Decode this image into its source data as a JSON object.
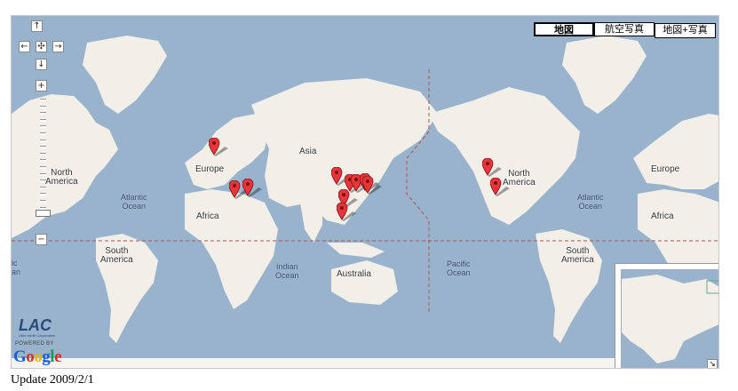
{
  "map": {
    "type_buttons": [
      {
        "label": "地図",
        "active": true
      },
      {
        "label": "航空写真",
        "active": false
      },
      {
        "label": "地図+写真",
        "active": false
      }
    ],
    "nav_controls": {
      "up": "↑",
      "down": "↓",
      "left": "←",
      "right": "→",
      "center": "✣",
      "zoom_in": "+",
      "zoom_out": "−"
    },
    "zoom_level_fraction": 0.05,
    "labels": {
      "north_america_left": "North\nAmerica",
      "europe_left": "Europe",
      "asia": "Asia",
      "africa_left": "Africa",
      "atlantic_left": "Atlantic\nOcean",
      "south_america_left": "South\nAmerica",
      "indian_ocean": "Indian\nOcean",
      "australia": "Australia",
      "pacific_ocean": "Pacific\nOcean",
      "north_america_right": "North\nAmerica",
      "atlantic_right": "Atlantic\nOcean",
      "europe_right": "Europe",
      "africa_right": "Africa",
      "south_america_right": "South\nAmerica",
      "antarctic_fragment": "ic\nan"
    },
    "markers": [
      {
        "name": "Finland"
      },
      {
        "name": "Turkey"
      },
      {
        "name": "Iran"
      },
      {
        "name": "Beijing"
      },
      {
        "name": "Korea"
      },
      {
        "name": "Korea 2"
      },
      {
        "name": "Japan"
      },
      {
        "name": "Tokyo"
      },
      {
        "name": "Shanghai"
      },
      {
        "name": "Taiwan"
      },
      {
        "name": "Seattle"
      },
      {
        "name": "San Francisco"
      }
    ],
    "overview_toggle": "↘",
    "colors": {
      "water": "#99b3cc",
      "land": "#f2efe9",
      "marker": "#e8343a",
      "border_line": "#b05050"
    }
  },
  "branding": {
    "lac_logo": "LAC",
    "lac_subtitle": "Little eArth Corporation",
    "powered_by": "POWERED BY",
    "google": [
      "G",
      "o",
      "o",
      "g",
      "l",
      "e"
    ],
    "google_colors": [
      "#1a5bd6",
      "#d62d20",
      "#f0b400",
      "#1a5bd6",
      "#0f9d58",
      "#d62d20"
    ]
  },
  "footer": {
    "update_text": "Update 2009/2/1"
  }
}
